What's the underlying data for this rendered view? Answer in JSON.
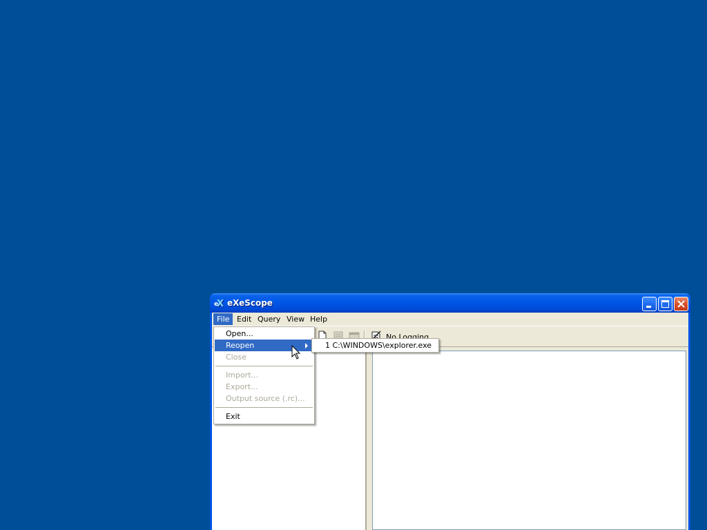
{
  "window": {
    "title": "eXeScope"
  },
  "menubar": {
    "items": [
      {
        "label": "File",
        "active": true
      },
      {
        "label": "Edit"
      },
      {
        "label": "Query"
      },
      {
        "label": "View"
      },
      {
        "label": "Help"
      }
    ]
  },
  "toolbar": {
    "logging_label": "No Logging"
  },
  "file_menu": {
    "items": [
      {
        "label": "Open...",
        "enabled": true
      },
      {
        "label": "Reopen",
        "enabled": true,
        "highlighted": true,
        "has_submenu": true
      },
      {
        "label": "Close",
        "enabled": false
      },
      {
        "label": "Import...",
        "enabled": false
      },
      {
        "label": "Export...",
        "enabled": false
      },
      {
        "label": "Output source (.rc)...",
        "enabled": false
      },
      {
        "label": "Exit",
        "enabled": true
      }
    ]
  },
  "reopen_submenu": {
    "items": [
      {
        "label": "1 C:\\WINDOWS\\explorer.exe"
      }
    ]
  },
  "colors": {
    "desktop": "#004e98",
    "highlight": "#316ac5",
    "disabled_text": "#aca899"
  }
}
